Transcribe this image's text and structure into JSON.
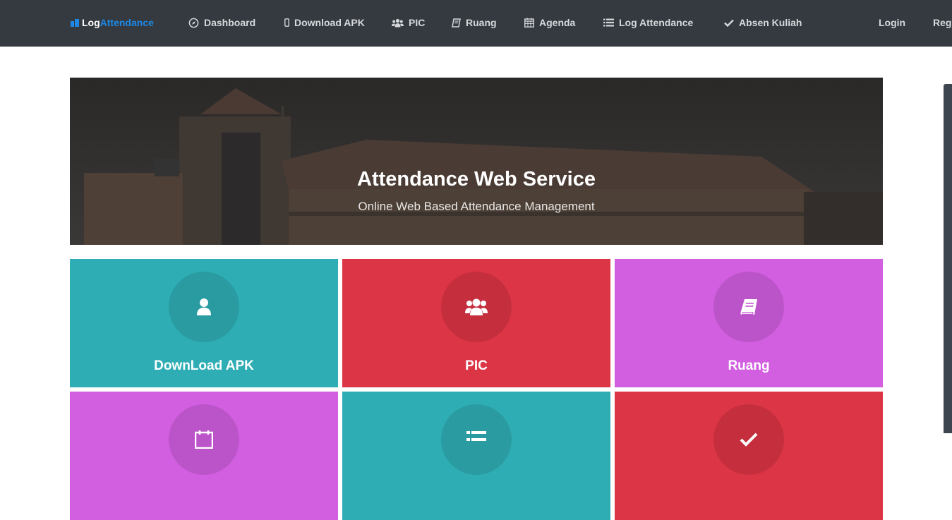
{
  "brand": {
    "part1": "Log",
    "part2": "Attendance"
  },
  "nav": {
    "dashboard": "Dashboard",
    "download_apk": "Download APK",
    "pic": "PIC",
    "ruang": "Ruang",
    "agenda": "Agenda",
    "log_attendance": "Log Attendance",
    "absen_kuliah": "Absen Kuliah",
    "login": "Login",
    "register": "Reg"
  },
  "hero": {
    "title": "Attendance Web Service",
    "subtitle": "Online Web Based Attendance Management"
  },
  "tiles": [
    {
      "label": "DownLoad APK",
      "icon": "user-icon",
      "color": "#2fadb4"
    },
    {
      "label": "PIC",
      "icon": "users-icon",
      "color": "#dc3545"
    },
    {
      "label": "Ruang",
      "icon": "book-icon",
      "color": "#d25ee0"
    },
    {
      "label": "",
      "icon": "calendar-icon",
      "color": "#d25ee0"
    },
    {
      "label": "",
      "icon": "list-icon",
      "color": "#2fadb4"
    },
    {
      "label": "",
      "icon": "check-icon",
      "color": "#dc3545"
    }
  ],
  "colors": {
    "navbar": "#343a40",
    "brand_accent": "#1e88e5",
    "teal": "#2fadb4",
    "red": "#dc3545",
    "violet": "#d25ee0"
  }
}
